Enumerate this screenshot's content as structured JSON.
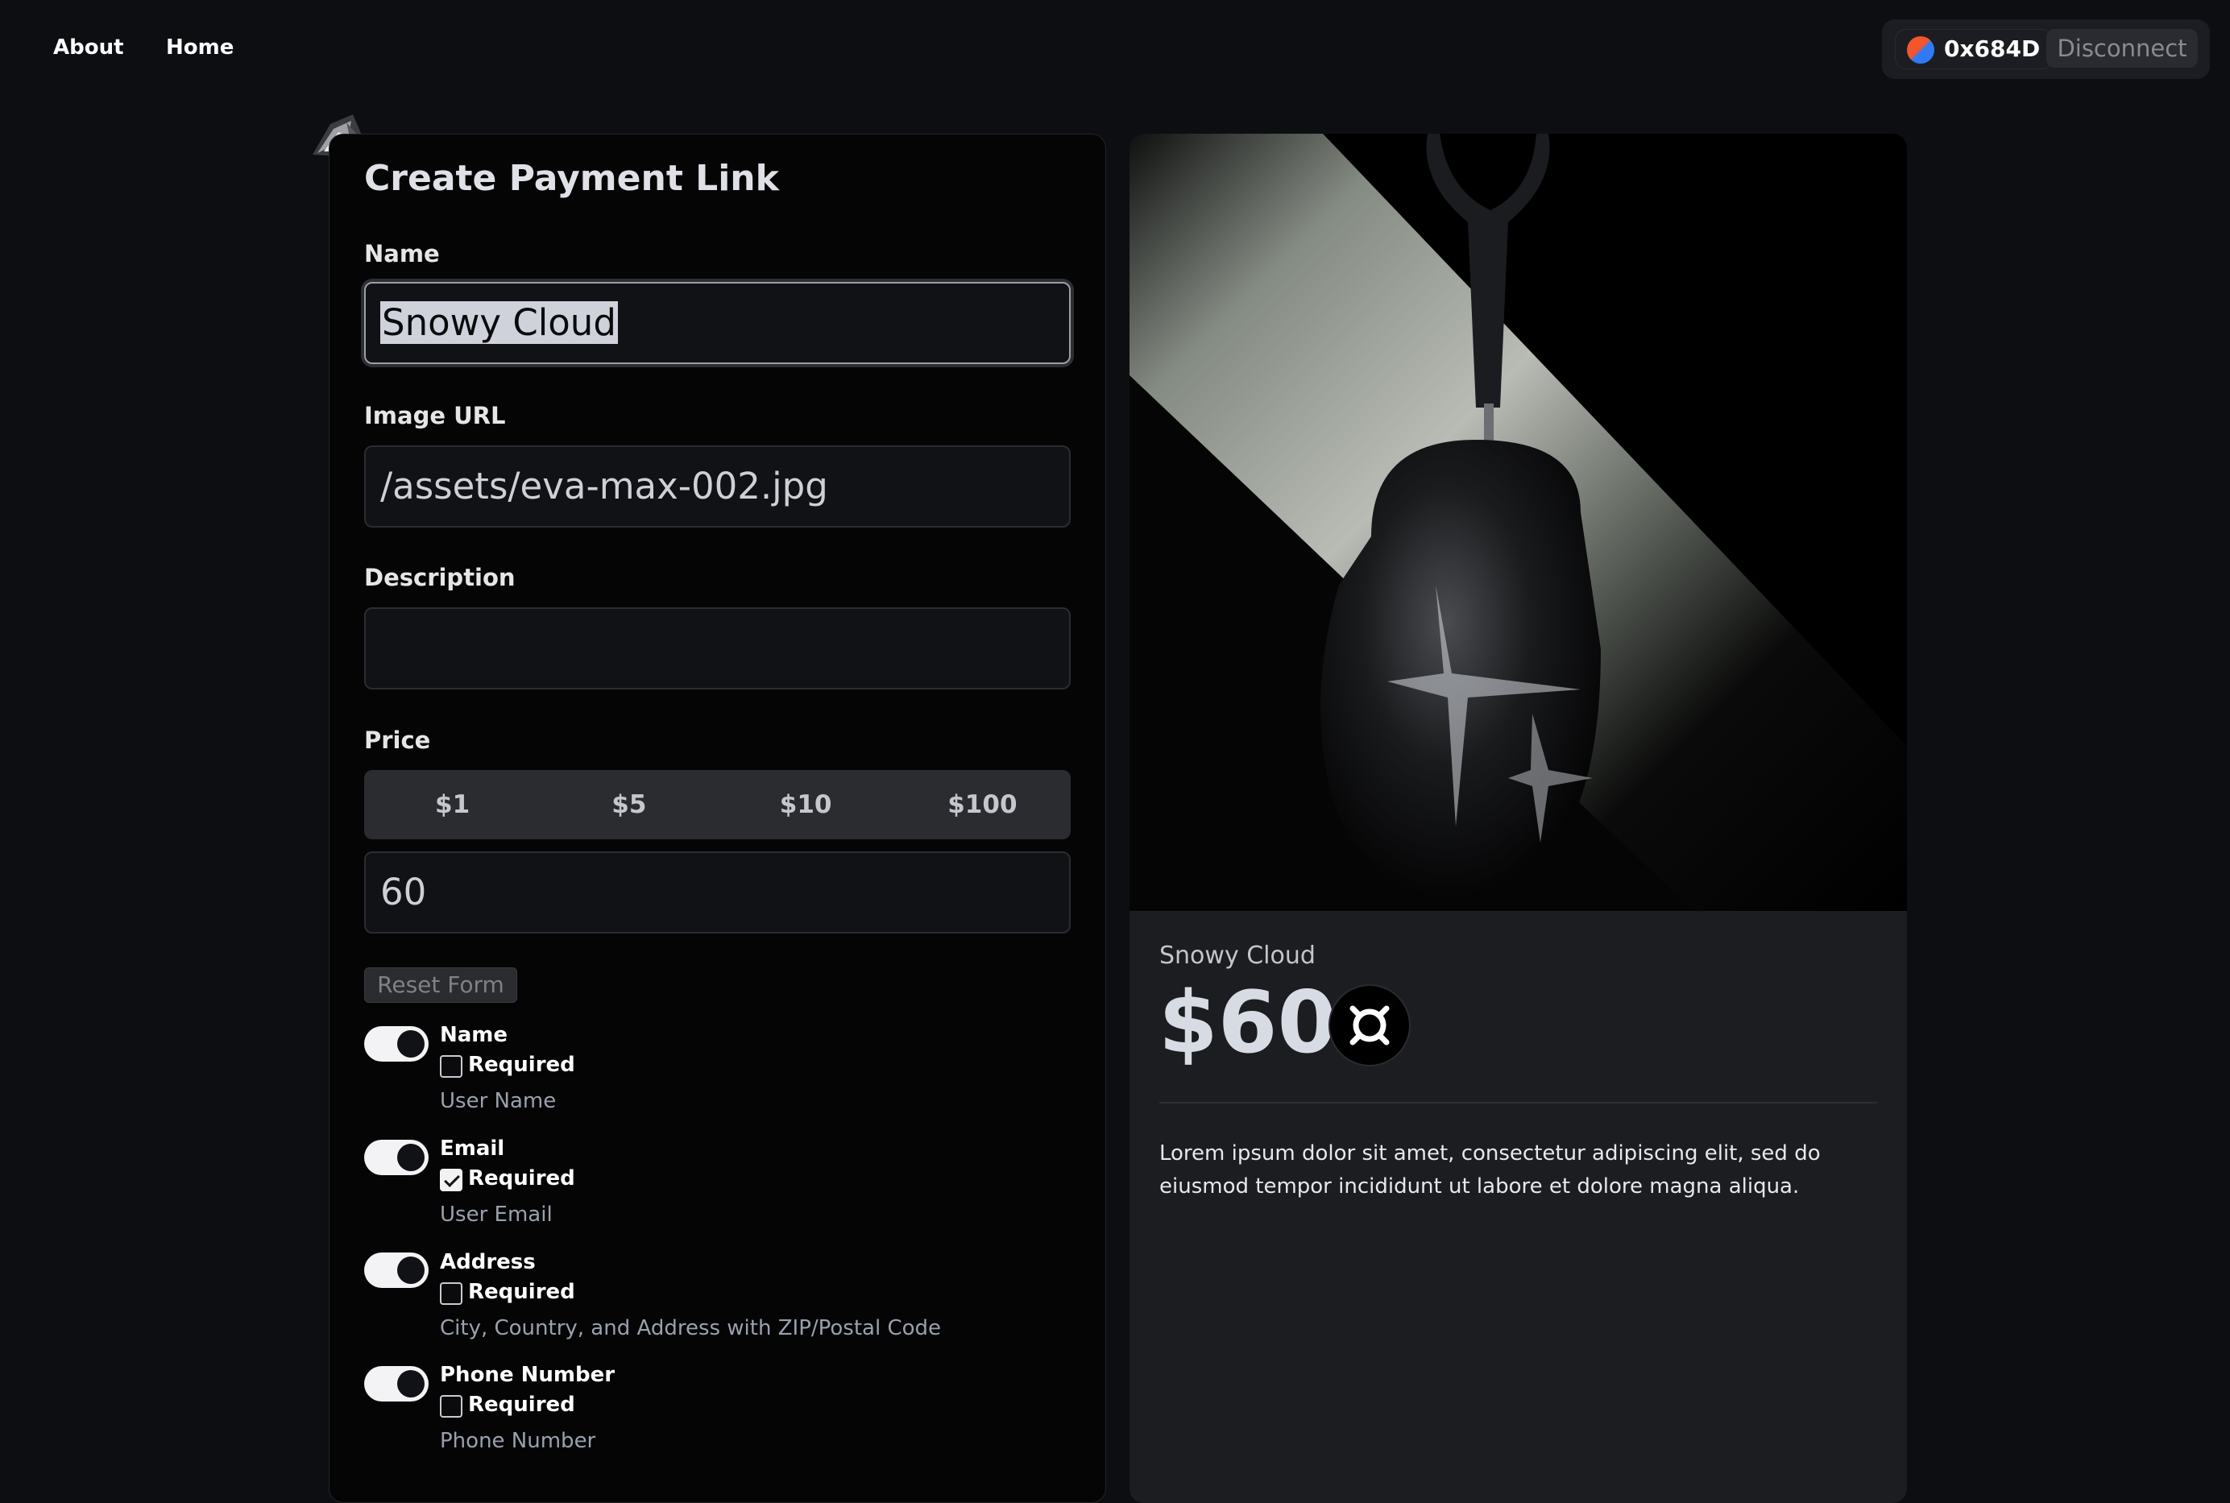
{
  "nav": {
    "about_label": "About",
    "home_label": "Home"
  },
  "wallet": {
    "address": "0x684D",
    "disconnect_label": "Disconnect"
  },
  "form": {
    "title": "Create Payment Link",
    "name_label": "Name",
    "name_value": "Snowy Cloud",
    "image_url_label": "Image URL",
    "image_url_value": "/assets/eva-max-002.jpg",
    "description_label": "Description",
    "description_value": "",
    "price_label": "Price",
    "price_presets": [
      "$1",
      "$5",
      "$10",
      "$100"
    ],
    "price_value": "60",
    "reset_label": "Reset Form",
    "options": [
      {
        "label": "Name",
        "enabled": true,
        "required": false,
        "required_label": "Required",
        "hint": "User Name"
      },
      {
        "label": "Email",
        "enabled": true,
        "required": true,
        "required_label": "Required",
        "hint": "User Email"
      },
      {
        "label": "Address",
        "enabled": true,
        "required": false,
        "required_label": "Required",
        "hint": "City, Country, and Address with ZIP/Postal Code"
      },
      {
        "label": "Phone Number",
        "enabled": true,
        "required": false,
        "required_label": "Required",
        "hint": "Phone Number"
      }
    ]
  },
  "preview": {
    "product_name": "Snowy Cloud",
    "price": "$60",
    "description": "Lorem ipsum dolor sit amet, consectetur adipiscing elit, sed do eiusmod tempor incididunt ut labore et dolore magna aliqua.",
    "token_icon": "token-coin-icon"
  },
  "colors": {
    "background": "#0d0e12",
    "card": "#050506",
    "preview_card": "#1c1d20",
    "toggle_on": "#f3f3f5"
  }
}
